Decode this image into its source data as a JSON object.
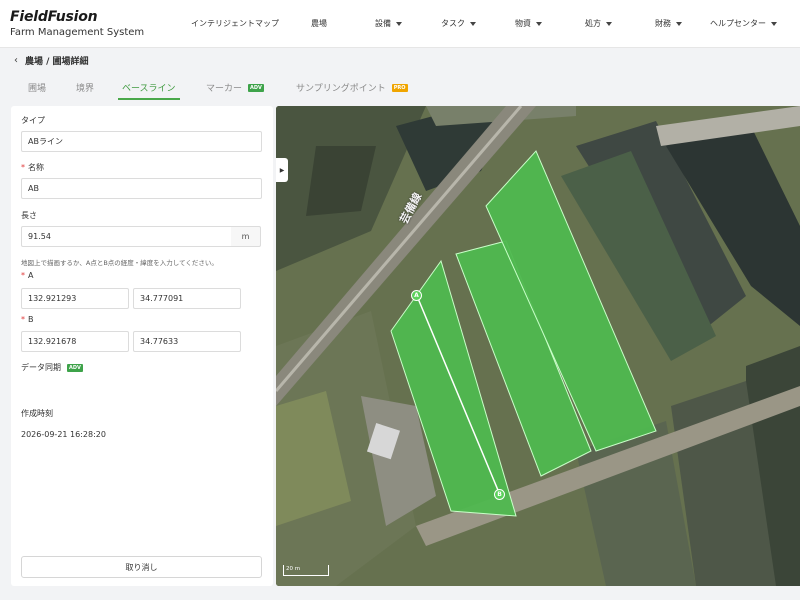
{
  "header": {
    "brand": "FieldFusion",
    "subtitle": "Farm Management System",
    "nav": [
      {
        "label": "インテリジェントマップ"
      },
      {
        "label": "農場"
      },
      {
        "label": "設備"
      },
      {
        "label": "タスク"
      },
      {
        "label": "物資"
      },
      {
        "label": "処方"
      },
      {
        "label": "財務"
      },
      {
        "label": "ヘルプセンター"
      }
    ]
  },
  "breadcrumb": {
    "back_icon": "chevron-left-icon",
    "title": "農場 / 圃場詳細"
  },
  "tabs": [
    {
      "label": "圃場"
    },
    {
      "label": "境界"
    },
    {
      "label": "ベースライン"
    },
    {
      "label": "マーカー",
      "badge": "ADV"
    },
    {
      "label": "サンプリングポイント",
      "badge": "PRO"
    }
  ],
  "active_tab": "ベースライン",
  "form": {
    "type_label": "タイプ",
    "type_value": "ABライン",
    "name_label": "名称",
    "name_value": "AB",
    "length_label": "長さ",
    "length_value": "91.54",
    "length_unit": "m",
    "hint": "地図上で描画するか、A点とB点の経度・緯度を入力してください。",
    "a_label": "A",
    "a_lon": "132.921293",
    "a_lat": "34.777091",
    "b_label": "B",
    "b_lon": "132.921678",
    "b_lat": "34.77633",
    "sync_label": "データ同期",
    "sync_badge": "ADV",
    "created_label": "作成時刻",
    "created_value": "2026-09-21 16:28:20",
    "cancel_label": "取り消し"
  },
  "map": {
    "railway_label": "芸備線",
    "scale_label": "20 m",
    "point_a": "A",
    "point_b": "B",
    "toggle_icon": "chevron-right-icon",
    "field_color": "#4fb84f",
    "baseline_color": "#ffffff"
  }
}
